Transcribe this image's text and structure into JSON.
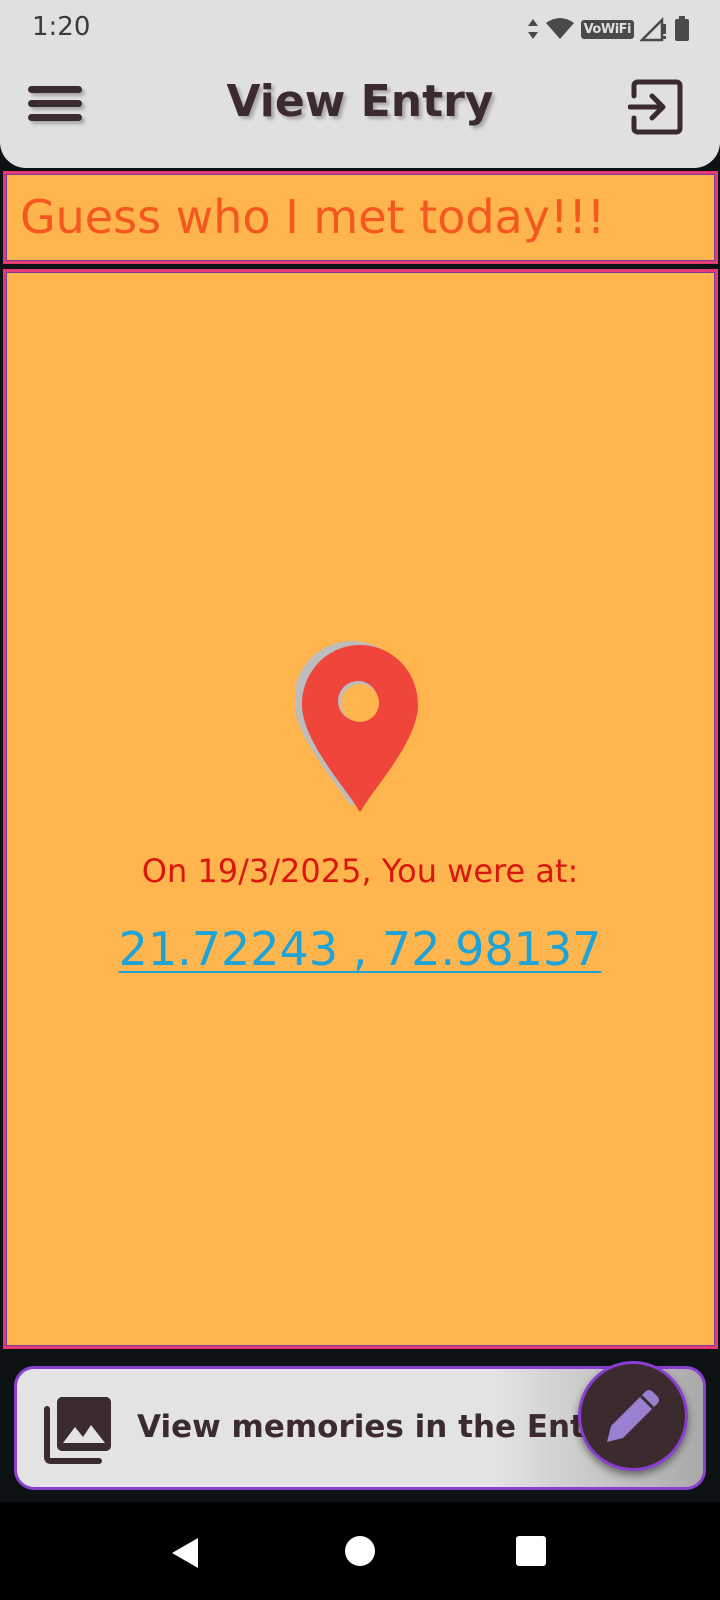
{
  "status_bar": {
    "time": "1:20",
    "icons": [
      "data-arrows-icon",
      "wifi-icon",
      "vowifi-icon",
      "signal-icon",
      "battery-icon"
    ],
    "vowifi_label": "VoWiFi"
  },
  "app_bar": {
    "title": "View Entry",
    "left_icon": "menu-icon",
    "right_icon": "logout-icon"
  },
  "entry": {
    "title": "Guess who I met today!!!",
    "location_icon": "map-pin-icon",
    "date_text": "On 19/3/2025, You were at:",
    "coordinates": "21.72243 , 72.98137"
  },
  "bottom": {
    "memories_label": "View memories in the Entry",
    "memories_icon": "photo-library-icon",
    "fab_icon": "pencil-icon"
  },
  "nav_bar": {
    "icons": [
      "back-icon",
      "home-icon",
      "recents-icon"
    ]
  },
  "colors": {
    "bar_bg": "#e0e0e0",
    "card_bg": "#ffb54e",
    "card_border": "#e53a73",
    "title_orange": "#f4581e",
    "date_red": "#d9170c",
    "link_blue": "#1ea3d8",
    "pin_red": "#f0453a",
    "fab_bg": "#3b2a2e",
    "fab_pencil": "#9b7fd0"
  }
}
